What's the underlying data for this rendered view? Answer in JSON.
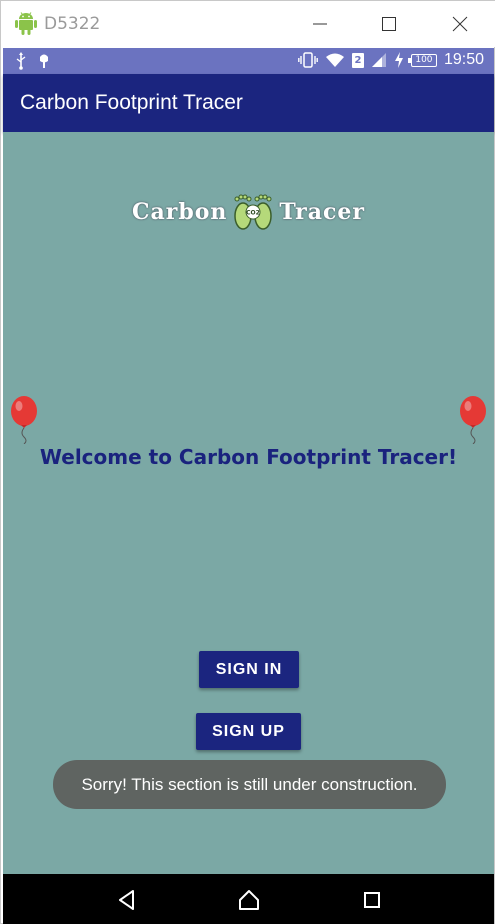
{
  "window": {
    "title": "D5322"
  },
  "status_bar": {
    "sim_slot": "2",
    "battery_level": "100",
    "time": "19:50",
    "color": "#6b73c0"
  },
  "app_bar": {
    "title": "Carbon Footprint Tracer",
    "color": "#1b257f"
  },
  "logo": {
    "left_text": "Carbon",
    "right_text": "Tracer",
    "footprint_badge": "CO2"
  },
  "welcome": {
    "text": "Welcome to Carbon Footprint Tracer!"
  },
  "buttons": {
    "sign_in": "SIGN IN",
    "sign_up": "SIGN UP"
  },
  "toast": {
    "message": "Sorry! This section is still under construction."
  },
  "colors": {
    "background": "#7ba8a5",
    "primary": "#1b257f",
    "balloon": "#e53935"
  }
}
